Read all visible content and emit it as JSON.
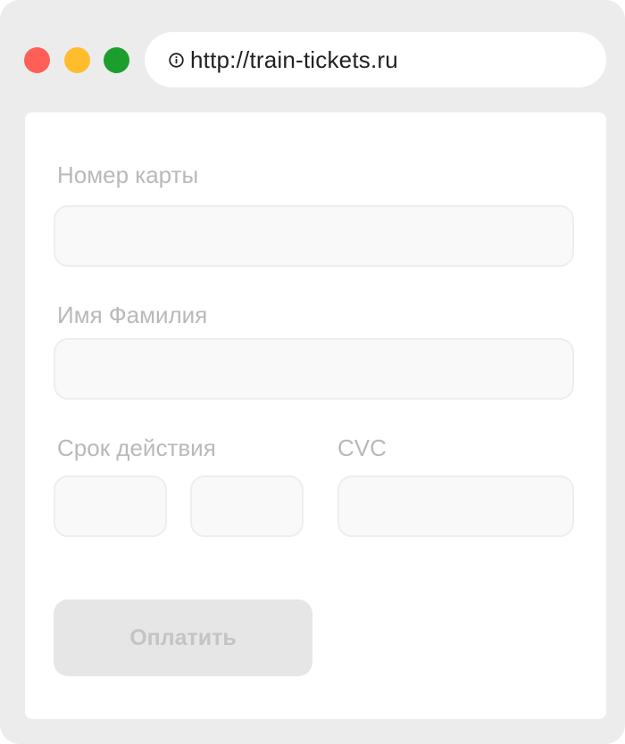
{
  "browser": {
    "url": "http://train-tickets.ru",
    "icons": {
      "traffic_lights": [
        "close-dot",
        "minimize-dot",
        "maximize-dot"
      ],
      "url_icon": "info-icon"
    },
    "colors": {
      "close": "#ff5f57",
      "minimize": "#ffbd2e",
      "maximize": "#1c9e2e"
    }
  },
  "form": {
    "card_number_label": "Номер карты",
    "card_number_value": "",
    "name_label": "Имя Фамилия",
    "name_value": "",
    "expiry_label": "Срок действия",
    "expiry_month_value": "",
    "expiry_year_value": "",
    "cvc_label": "CVC",
    "cvc_value": "",
    "pay_button_label": "Оплатить",
    "pay_button_disabled": true
  }
}
